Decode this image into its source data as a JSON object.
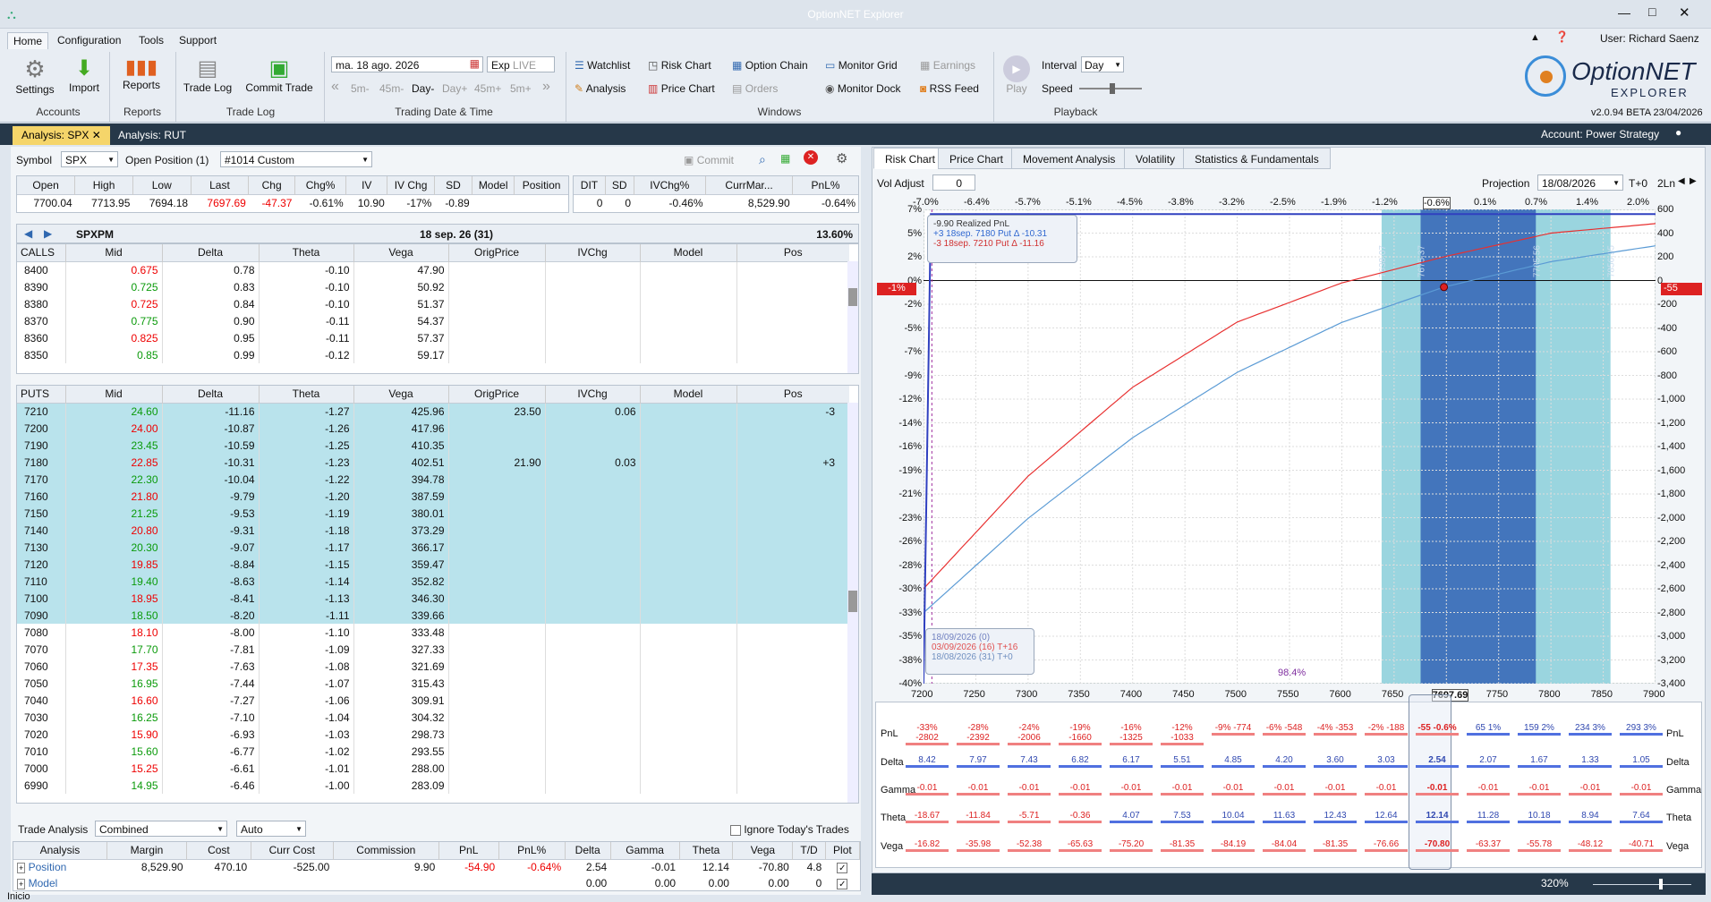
{
  "app": {
    "title": "OptionNET Explorer",
    "user": "User: Richard Saenz",
    "version": "v2.0.94 BETA 23/04/2026",
    "account": "Account: Power Strategy",
    "logo_text_1": "OptionNET",
    "logo_text_2": "EXPLORER"
  },
  "ribbon": {
    "tabs": [
      "Home",
      "Configuration",
      "Tools",
      "Support"
    ],
    "settings": "Settings",
    "import": "Import",
    "reports": "Reports",
    "trade_log": "Trade Log",
    "commit_trade": "Commit Trade",
    "groups": [
      "Accounts",
      "Reports",
      "Trade Log",
      "Trading Date & Time",
      "Windows",
      "Playback"
    ],
    "date": "ma. 18 ago. 2026",
    "exp": "Exp",
    "live": "LIVE",
    "steps": [
      "5m-",
      "45m-",
      "Day-",
      "Day+",
      "45m+",
      "5m+"
    ],
    "watchlist": "Watchlist",
    "analysis": "Analysis",
    "risk_chart": "Risk Chart",
    "price_chart": "Price Chart",
    "option_chain": "Option Chain",
    "orders": "Orders",
    "monitor_grid": "Monitor Grid",
    "monitor_dock": "Monitor Dock",
    "earnings": "Earnings",
    "rss_feed": "RSS Feed",
    "play": "Play",
    "interval_label": "Interval",
    "interval": "Day",
    "speed": "Speed"
  },
  "doc_tabs": [
    "Analysis: SPX",
    "Analysis: RUT"
  ],
  "left": {
    "symbol_label": "Symbol",
    "symbol": "SPX",
    "open_position_label": "Open Position (1)",
    "position": "#1014 Custom",
    "commit": "Commit",
    "quote_headers": [
      "Open",
      "High",
      "Low",
      "Last",
      "Chg",
      "Chg%",
      "IV",
      "IV Chg",
      "SD",
      "Model",
      "Position"
    ],
    "quote_values": [
      "7700.04",
      "7713.95",
      "7694.18",
      "7697.69",
      "-47.37",
      "-0.61%",
      "10.90",
      "-17%",
      "-0.89",
      "",
      ""
    ],
    "stat_headers": [
      "DIT",
      "SD",
      "IVChg%",
      "CurrMar...",
      "PnL%"
    ],
    "stat_values": [
      "0",
      "0",
      "-0.46%",
      "8,529.90",
      "-0.64%"
    ],
    "chain": {
      "root": "SPXPM",
      "expiry": "18 sep. 26 (31)",
      "iv": "13.60%"
    },
    "columns": [
      "Mid",
      "Delta",
      "Theta",
      "Vega",
      "OrigPrice",
      "IVChg",
      "Model",
      "Pos"
    ],
    "calls_label": "CALLS",
    "puts_label": "PUTS",
    "calls": [
      [
        "8400",
        "0.675",
        "0.78",
        "-0.10",
        "47.90"
      ],
      [
        "8390",
        "0.725",
        "0.83",
        "-0.10",
        "50.92"
      ],
      [
        "8380",
        "0.725",
        "0.84",
        "-0.10",
        "51.37"
      ],
      [
        "8370",
        "0.775",
        "0.90",
        "-0.11",
        "54.37"
      ],
      [
        "8360",
        "0.825",
        "0.95",
        "-0.11",
        "57.37"
      ],
      [
        "8350",
        "0.85",
        "0.99",
        "-0.12",
        "59.17"
      ]
    ],
    "puts": [
      [
        "7210",
        "24.60",
        "-11.16",
        "-1.27",
        "425.96",
        "23.50",
        "0.06",
        "-3"
      ],
      [
        "7200",
        "24.00",
        "-10.87",
        "-1.26",
        "417.96",
        "",
        "",
        ""
      ],
      [
        "7190",
        "23.45",
        "-10.59",
        "-1.25",
        "410.35",
        "",
        "",
        ""
      ],
      [
        "7180",
        "22.85",
        "-10.31",
        "-1.23",
        "402.51",
        "21.90",
        "0.03",
        "+3"
      ],
      [
        "7170",
        "22.30",
        "-10.04",
        "-1.22",
        "394.78",
        "",
        "",
        ""
      ],
      [
        "7160",
        "21.80",
        "-9.79",
        "-1.20",
        "387.59",
        "",
        "",
        ""
      ],
      [
        "7150",
        "21.25",
        "-9.53",
        "-1.19",
        "380.01",
        "",
        "",
        ""
      ],
      [
        "7140",
        "20.80",
        "-9.31",
        "-1.18",
        "373.29",
        "",
        "",
        ""
      ],
      [
        "7130",
        "20.30",
        "-9.07",
        "-1.17",
        "366.17",
        "",
        "",
        ""
      ],
      [
        "7120",
        "19.85",
        "-8.84",
        "-1.15",
        "359.47",
        "",
        "",
        ""
      ],
      [
        "7110",
        "19.40",
        "-8.63",
        "-1.14",
        "352.82",
        "",
        "",
        ""
      ],
      [
        "7100",
        "18.95",
        "-8.41",
        "-1.13",
        "346.30",
        "",
        "",
        ""
      ],
      [
        "7090",
        "18.50",
        "-8.20",
        "-1.11",
        "339.66",
        "",
        "",
        ""
      ],
      [
        "7080",
        "18.10",
        "-8.00",
        "-1.10",
        "333.48",
        "",
        "",
        ""
      ],
      [
        "7070",
        "17.70",
        "-7.81",
        "-1.09",
        "327.33",
        "",
        "",
        ""
      ],
      [
        "7060",
        "17.35",
        "-7.63",
        "-1.08",
        "321.69",
        "",
        "",
        ""
      ],
      [
        "7050",
        "16.95",
        "-7.44",
        "-1.07",
        "315.43",
        "",
        "",
        ""
      ],
      [
        "7040",
        "16.60",
        "-7.27",
        "-1.06",
        "309.91",
        "",
        "",
        ""
      ],
      [
        "7030",
        "16.25",
        "-7.10",
        "-1.04",
        "304.32",
        "",
        "",
        ""
      ],
      [
        "7020",
        "15.90",
        "-6.93",
        "-1.03",
        "298.73",
        "",
        "",
        ""
      ],
      [
        "7010",
        "15.60",
        "-6.77",
        "-1.02",
        "293.55",
        "",
        "",
        ""
      ],
      [
        "7000",
        "15.25",
        "-6.61",
        "-1.01",
        "288.00",
        "",
        "",
        ""
      ],
      [
        "6990",
        "14.95",
        "-6.46",
        "-1.00",
        "283.09",
        "",
        "",
        ""
      ]
    ],
    "trade_analysis_label": "Trade Analysis",
    "ta_mode": "Combined",
    "ta_auto": "Auto",
    "ignore_today": "Ignore Today's Trades",
    "ta_headers": [
      "Analysis",
      "Margin",
      "Cost",
      "Curr Cost",
      "Commission",
      "PnL",
      "PnL%",
      "Delta",
      "Gamma",
      "Theta",
      "Vega",
      "T/D",
      "Plot"
    ],
    "ta_rows": [
      [
        "Position",
        "8,529.90",
        "470.10",
        "-525.00",
        "9.90",
        "-54.90",
        "-0.64%",
        "2.54",
        "-0.01",
        "12.14",
        "-70.80",
        "4.8"
      ],
      [
        "Model",
        "",
        "",
        "",
        "",
        "",
        "",
        "0.00",
        "0.00",
        "0.00",
        "0.00",
        "0"
      ]
    ],
    "status": "Inicio"
  },
  "right": {
    "tabs": [
      "Risk Chart",
      "Price Chart",
      "Movement Analysis",
      "Volatility",
      "Statistics & Fundamentals"
    ],
    "vol_adjust": "Vol Adjust",
    "vol_value": "0",
    "projection": "Projection",
    "proj_date": "18/08/2026",
    "t0": "T+0",
    "ln": "2Ln",
    "legend": [
      "-9.90 Realized PnL",
      "+3 18sep. 7180 Put Δ -10.31",
      "-3 18sep. 7210 Put Δ -11.16"
    ],
    "dates": [
      "18/09/2026 (0)",
      "03/09/2026 (16) T+16",
      "18/08/2026 (31) T+0"
    ],
    "prob": "98.4%",
    "zoom": "320%",
    "current_price": "7697.69",
    "cur_pct": "-1%",
    "cur_pnl": "-55",
    "band_labels": [
      "7638.07",
      "7675.37",
      "7785.56",
      "7856.95"
    ],
    "greek_labels": [
      "PnL",
      "Delta",
      "Gamma",
      "Theta",
      "Vega"
    ],
    "pnl": [
      "-33% -2802",
      "-28% -2392",
      "-24% -2006",
      "-19% -1660",
      "-16% -1325",
      "-12% -1033",
      "-9% -774",
      "-6% -548",
      "-4% -353",
      "-2% -188",
      "-55 -0.6%",
      "65 1%",
      "159 2%",
      "234 3%",
      "293 3%"
    ],
    "delta": [
      "8.42",
      "7.97",
      "7.43",
      "6.82",
      "6.17",
      "5.51",
      "4.85",
      "4.20",
      "3.60",
      "3.03",
      "2.54",
      "2.07",
      "1.67",
      "1.33",
      "1.05"
    ],
    "gamma": [
      "-0.01",
      "-0.01",
      "-0.01",
      "-0.01",
      "-0.01",
      "-0.01",
      "-0.01",
      "-0.01",
      "-0.01",
      "-0.01",
      "-0.01",
      "-0.01",
      "-0.01",
      "-0.01",
      "-0.01"
    ],
    "theta": [
      "-18.67",
      "-11.84",
      "-5.71",
      "-0.36",
      "4.07",
      "7.53",
      "10.04",
      "11.63",
      "12.43",
      "12.64",
      "12.14",
      "11.28",
      "10.18",
      "8.94",
      "7.64"
    ],
    "vega": [
      "-16.82",
      "-35.98",
      "-52.38",
      "-65.63",
      "-75.20",
      "-81.35",
      "-84.19",
      "-84.04",
      "-81.35",
      "-76.66",
      "-70.80",
      "-63.37",
      "-55.78",
      "-48.12",
      "-40.71"
    ]
  },
  "chart_data": {
    "type": "line",
    "x_range": [
      7200,
      7900
    ],
    "x_ticks": [
      "7200",
      "7250",
      "7300",
      "7350",
      "7400",
      "7450",
      "7500",
      "7550",
      "7600",
      "7650",
      "7697.69",
      "7750",
      "7800",
      "7850",
      "7900"
    ],
    "top_pct_ticks": [
      "-7.0%",
      "-6.4%",
      "-5.7%",
      "-5.1%",
      "-4.5%",
      "-3.8%",
      "-3.2%",
      "-2.5%",
      "-1.9%",
      "-1.2%",
      "-0.6%",
      "0.1%",
      "0.7%",
      "1.4%",
      "2.0%"
    ],
    "y_left_ticks": [
      "7%",
      "5%",
      "2%",
      "0%",
      "-2%",
      "-5%",
      "-7%",
      "-9%",
      "-12%",
      "-14%",
      "-16%",
      "-19%",
      "-21%",
      "-23%",
      "-26%",
      "-28%",
      "-30%",
      "-33%",
      "-35%",
      "-38%",
      "-40%"
    ],
    "y_right_ticks": [
      "600",
      "400",
      "200",
      "0",
      "-200",
      "-400",
      "-600",
      "-800",
      "-1,000",
      "-1,200",
      "-1,400",
      "-1,600",
      "-1,800",
      "-2,000",
      "-2,200",
      "-2,400",
      "-2,600",
      "-2,800",
      "-3,000",
      "-3,200",
      "-3,400"
    ],
    "series": [
      {
        "name": "18/08/2026 (31) T+0",
        "color": "#5b9bd5",
        "x": [
          7200,
          7300,
          7400,
          7500,
          7600,
          7697.69,
          7800,
          7900
        ],
        "y": [
          -2802,
          -2006,
          -1325,
          -774,
          -353,
          -55,
          159,
          293
        ]
      },
      {
        "name": "03/09/2026 (16) T+16",
        "color": "#e83030",
        "x": [
          7200,
          7300,
          7400,
          7500,
          7600,
          7697.69,
          7800,
          7900
        ],
        "y": [
          -2600,
          -1650,
          -900,
          -350,
          -20,
          200,
          400,
          480
        ]
      },
      {
        "name": "18/09/2026 (0)",
        "color": "#3040c0",
        "x": [
          7200,
          7210,
          7220,
          7900
        ],
        "y": [
          -3400,
          560,
          560,
          560
        ]
      }
    ]
  }
}
